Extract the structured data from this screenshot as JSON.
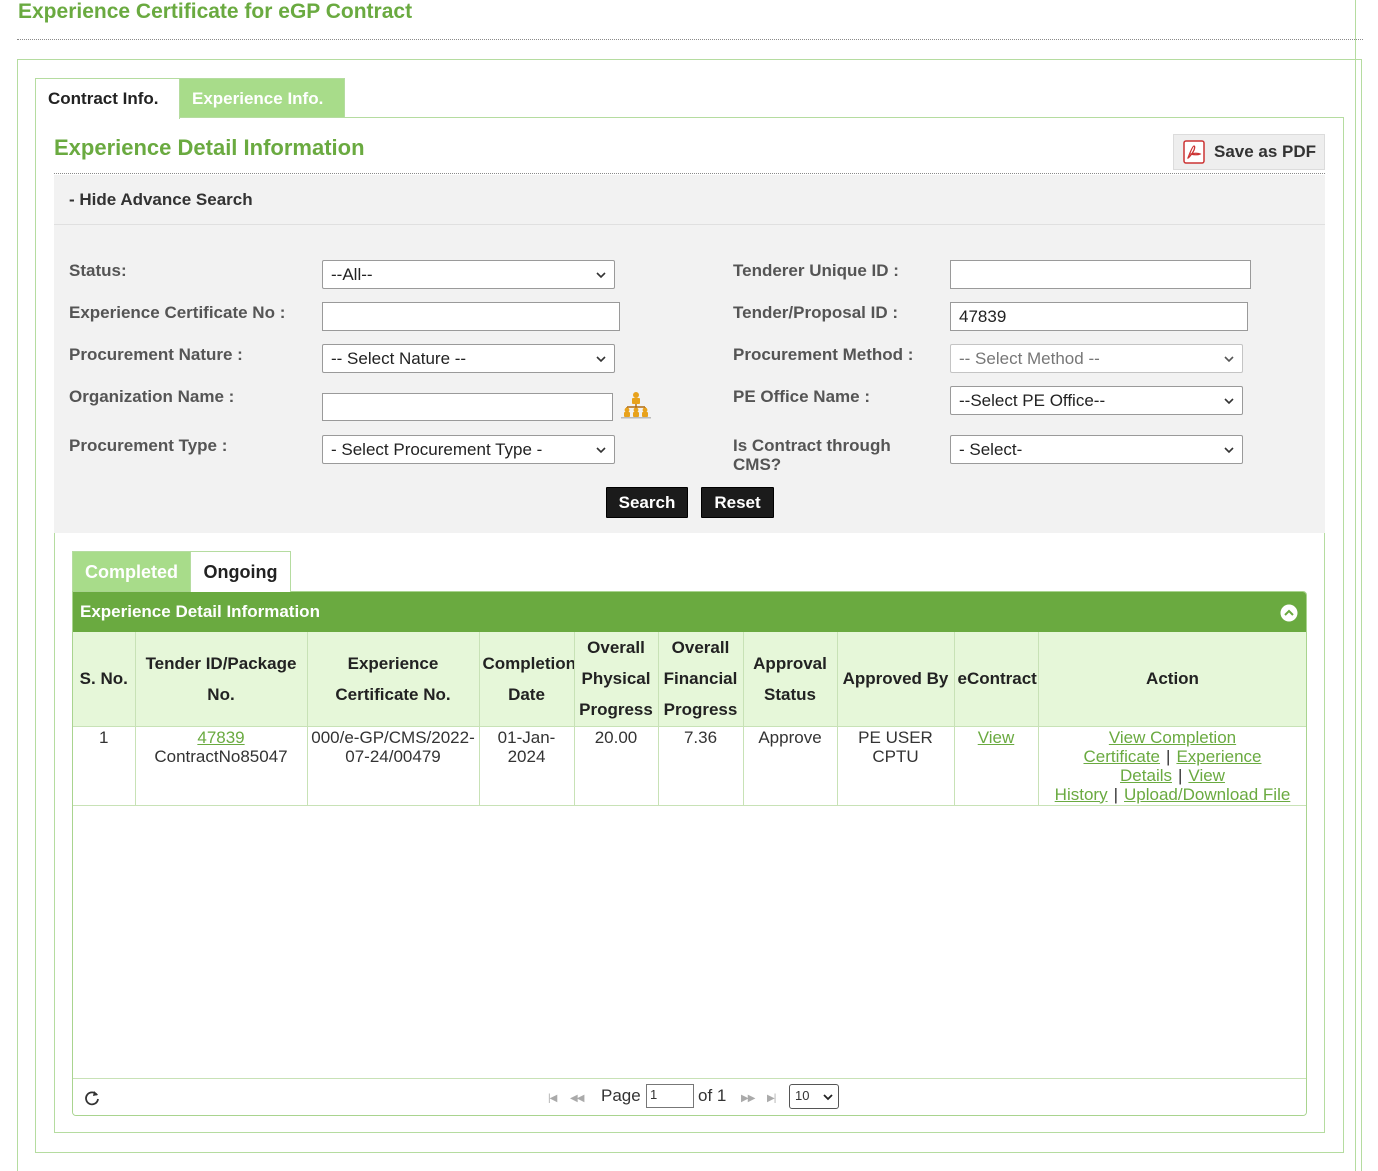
{
  "page": {
    "title": "Experience Certificate for eGP Contract"
  },
  "tabs": {
    "contract_info": "Contract Info.",
    "experience_info": "Experience Info."
  },
  "section": {
    "title": "Experience Detail Information",
    "save_pdf_label": "Save as PDF"
  },
  "search": {
    "toggle_label": "- Hide Advance Search",
    "labels": {
      "status": "Status:",
      "certificate_no": "Experience Certificate No :",
      "procurement_nature": "Procurement Nature :",
      "organization_name": "Organization Name :",
      "procurement_type": "Procurement Type :",
      "tenderer_unique_id": "Tenderer Unique ID :",
      "tender_proposal_id": "Tender/Proposal ID :",
      "procurement_method": "Procurement Method :",
      "pe_office_name": "PE Office Name :",
      "is_contract_cms": "Is Contract through CMS?"
    },
    "values": {
      "status": "--All--",
      "certificate_no": "",
      "procurement_nature": "-- Select Nature --",
      "organization_name": "",
      "procurement_type": "- Select Procurement Type -",
      "tenderer_unique_id": "",
      "tender_proposal_id": "47839",
      "procurement_method": "-- Select Method --",
      "pe_office_name": "--Select PE Office--",
      "is_contract_cms": "- Select-"
    },
    "search_button": "Search",
    "reset_button": "Reset"
  },
  "results": {
    "tabs": {
      "completed": "Completed",
      "ongoing": "Ongoing"
    },
    "grid_caption": "Experience Detail Information",
    "columns": [
      "S. No.",
      "Tender ID/Package No.",
      "Experience Certificate No.",
      "Completion Date",
      "Overall Physical Progress",
      "Overall Financial Progress",
      "Approval Status",
      "Approved By",
      "eContract",
      "Action"
    ],
    "rows": [
      {
        "s_no": "1",
        "tender_id": "47839",
        "package_no": "ContractNo85047",
        "certificate_no": "000/e-GP/CMS/2022-07-24/00479",
        "completion_date": "01-Jan-2024",
        "physical_progress": "20.00",
        "financial_progress": "7.36",
        "approval_status": "Approve",
        "approved_by": "PE USER CPTU",
        "econtract_link": "View",
        "actions": {
          "view_completion_certificate": "View Completion Certificate",
          "experience_details": "Experience Details",
          "view_history": "View History",
          "upload_download_file": "Upload/Download File",
          "separator": "|"
        }
      }
    ],
    "pager": {
      "page_label": "Page",
      "page_value": "1",
      "of_label": "of 1",
      "page_size": "10"
    }
  },
  "colors": {
    "accent_green": "#6aaa40",
    "tab_green": "#a8dc8a",
    "header_bg": "#e6f7d9",
    "border_green": "#b5dca0"
  }
}
